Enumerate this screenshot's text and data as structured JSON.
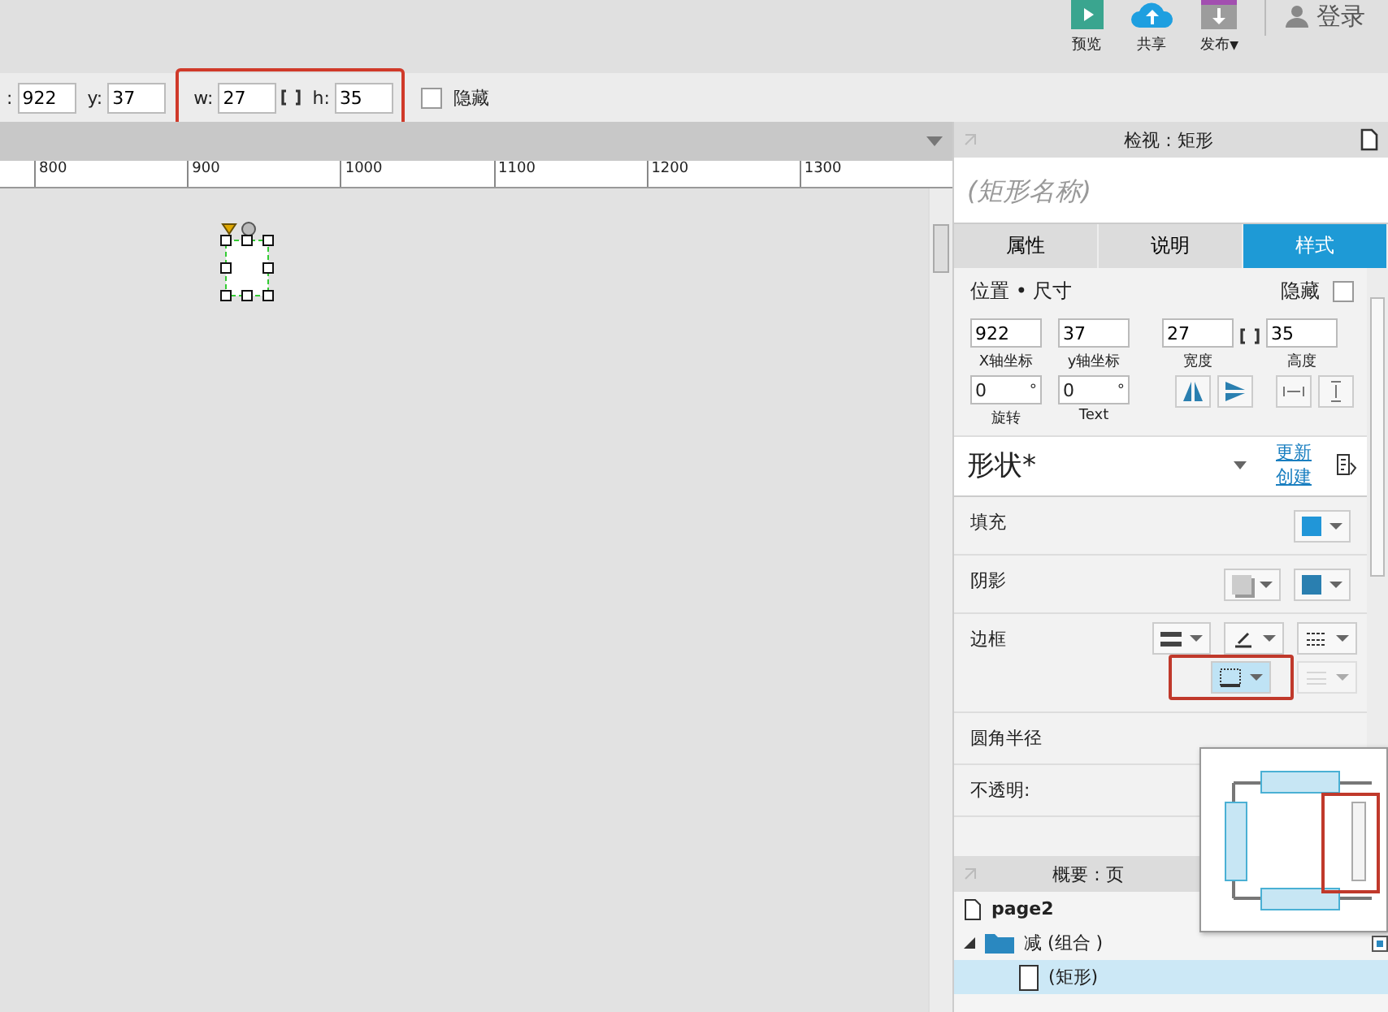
{
  "toolbar": {
    "buttons": [
      {
        "kind": "preview",
        "label": "预览"
      },
      {
        "kind": "share",
        "label": "共享"
      },
      {
        "kind": "publish",
        "label": "发布",
        "caret": "▼"
      }
    ],
    "login": "登录"
  },
  "geometry_bar": {
    "plain_fields": [
      {
        "label": ":",
        "value": "922"
      },
      {
        "label": "y:",
        "value": "37"
      }
    ],
    "highlighted_fields": [
      {
        "label": "w:",
        "value": "27"
      },
      {
        "label": "h:",
        "value": "35"
      }
    ],
    "hidden": {
      "label": "隐藏",
      "checked": false
    }
  },
  "ruler": {
    "ticks": [
      "800",
      "900",
      "1000",
      "1100",
      "1200",
      "1300"
    ]
  },
  "inspector": {
    "title": "检视 : 矩形",
    "name_placeholder": "(矩形名称)",
    "tabs": [
      {
        "label": "属性",
        "selected": false
      },
      {
        "label": "说明",
        "selected": false
      },
      {
        "label": "样式",
        "selected": true
      }
    ],
    "position_section": {
      "title": "位置 • 尺寸",
      "hidden": {
        "label": "隐藏",
        "checked": false
      },
      "fields": [
        {
          "value": "922",
          "caption": "X轴坐标"
        },
        {
          "value": "37",
          "caption": "y轴坐标"
        },
        {
          "value": "27",
          "caption": "宽度"
        },
        {
          "value": "35",
          "caption": "高度"
        }
      ],
      "angle_fields": [
        {
          "value": "0",
          "unit": "°",
          "caption": "旋转"
        },
        {
          "value": "0",
          "unit": "°",
          "caption": "Text"
        }
      ]
    },
    "style": {
      "name": "形状*",
      "links": [
        "更新",
        "创建"
      ]
    },
    "rows": [
      {
        "kind": "fill",
        "label": "填充"
      },
      {
        "kind": "shadow",
        "label": "阴影"
      },
      {
        "kind": "border",
        "label": "边框"
      },
      {
        "kind": "radius",
        "label": "圆角半径"
      },
      {
        "kind": "opacity",
        "label": "不透明:"
      }
    ]
  },
  "outline": {
    "title": "概要 : 页",
    "items": [
      {
        "kind": "page",
        "label": "page2",
        "selected": false,
        "children": [
          {
            "kind": "group",
            "label": "减 (组合 )",
            "expanded": true,
            "selected": false,
            "children": [
              {
                "kind": "shape",
                "label": "(矩形)",
                "selected": true
              }
            ]
          }
        ]
      }
    ]
  }
}
